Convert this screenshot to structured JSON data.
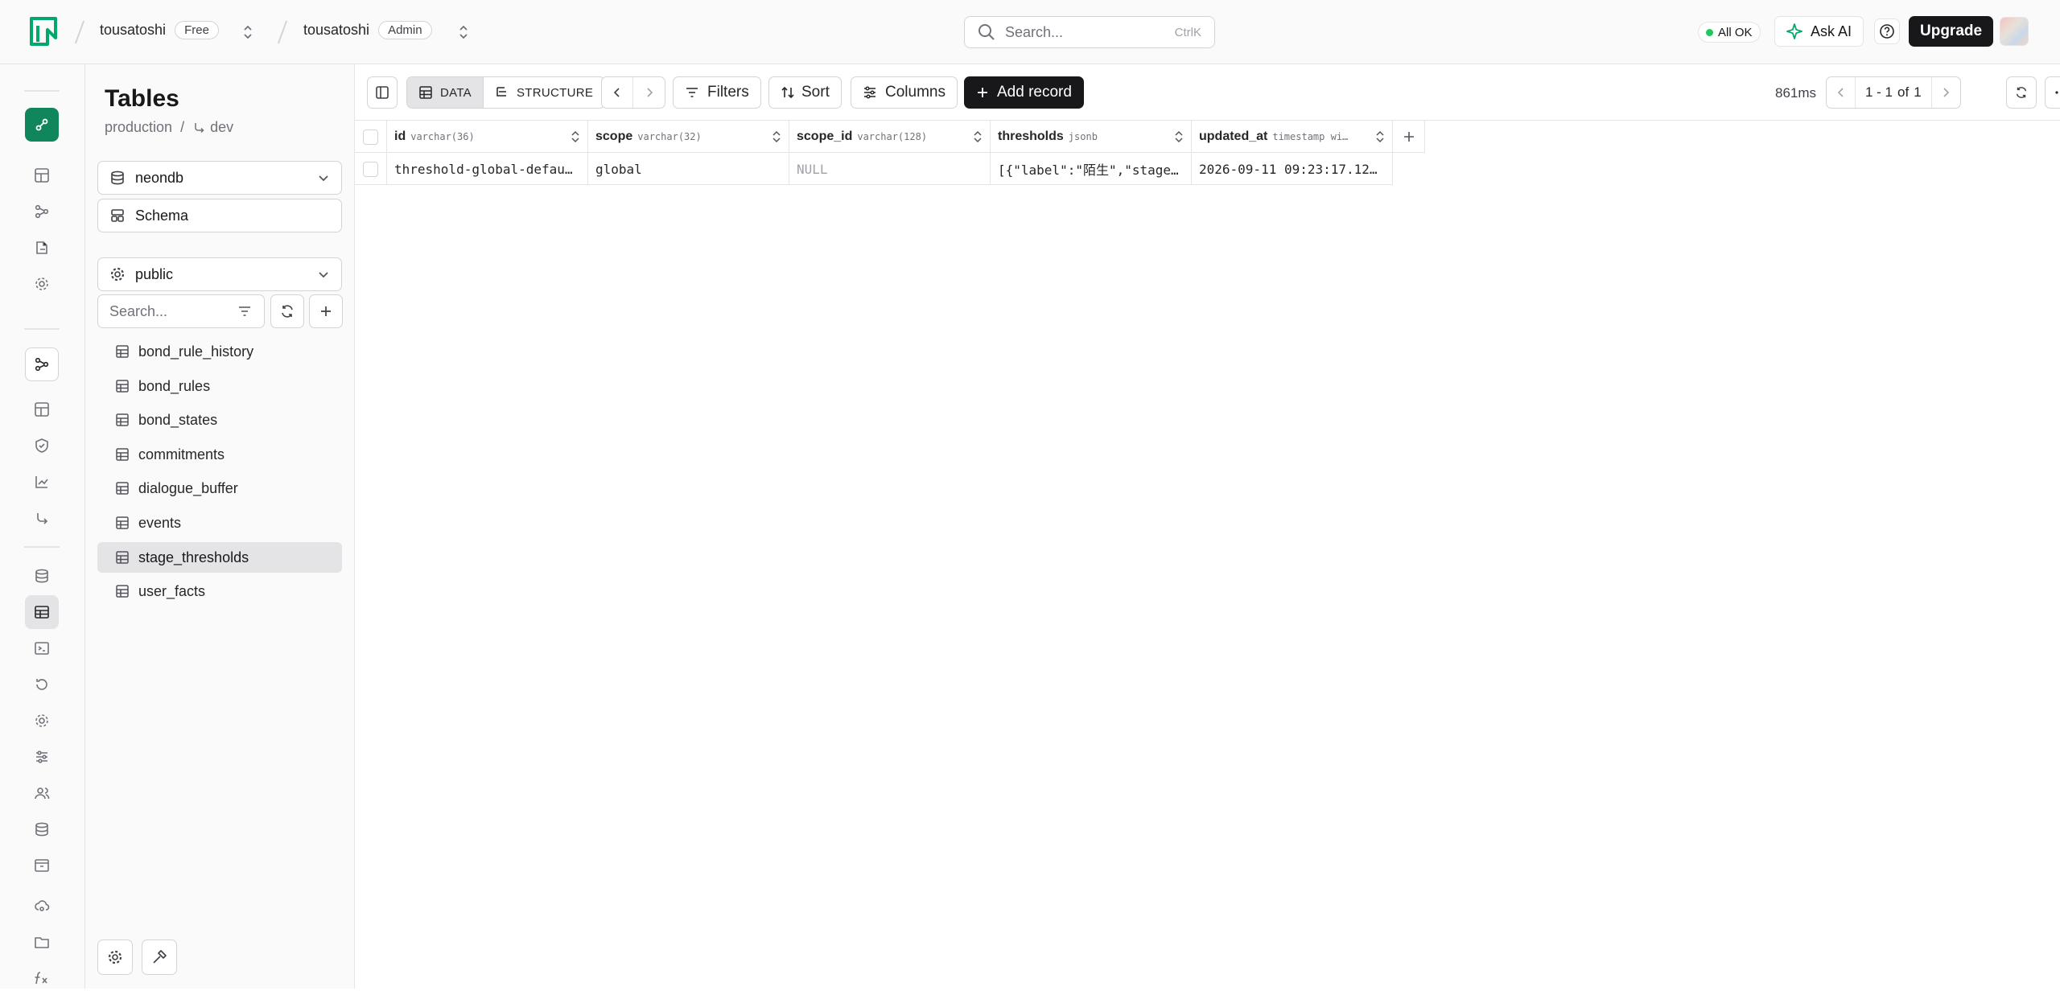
{
  "topbar": {
    "org": "tousatoshi",
    "org_plan": "Free",
    "project": "tousatoshi",
    "project_role": "Admin",
    "search_placeholder": "Search...",
    "search_shortcut": "CtrlK",
    "status": "All OK",
    "ask_ai": "Ask AI",
    "upgrade": "Upgrade"
  },
  "sidebar": {
    "title": "Tables",
    "breadcrumb_env": "production",
    "breadcrumb_sep": "/",
    "breadcrumb_branch": "dev",
    "database": "neondb",
    "schema_button": "Schema",
    "schema_name": "public",
    "search_placeholder": "Search...",
    "tables": [
      {
        "name": "bond_rule_history"
      },
      {
        "name": "bond_rules"
      },
      {
        "name": "bond_states"
      },
      {
        "name": "commitments"
      },
      {
        "name": "dialogue_buffer"
      },
      {
        "name": "events"
      },
      {
        "name": "stage_thresholds",
        "active": true
      },
      {
        "name": "user_facts"
      }
    ]
  },
  "toolbar": {
    "data_tab": "DATA",
    "structure_tab": "STRUCTURE",
    "filters": "Filters",
    "sort": "Sort",
    "columns": "Columns",
    "add_record": "Add record",
    "query_time": "861ms",
    "page_range": "1 - 1",
    "page_of": "of",
    "page_total": "1"
  },
  "table": {
    "columns": [
      {
        "name": "id",
        "type": "varchar(36)"
      },
      {
        "name": "scope",
        "type": "varchar(32)"
      },
      {
        "name": "scope_id",
        "type": "varchar(128)"
      },
      {
        "name": "thresholds",
        "type": "jsonb"
      },
      {
        "name": "updated_at",
        "type": "timestamp wi…"
      }
    ],
    "rows": [
      [
        "threshold-global-defau…",
        "global",
        "NULL",
        "[{\"label\":\"陌生\",\"stage…",
        "2026-09-11 09:23:17.12…"
      ]
    ]
  },
  "colors": {
    "brand": "#00a86b",
    "status_dot": "#22c55e",
    "primary_button": "#18181b"
  }
}
